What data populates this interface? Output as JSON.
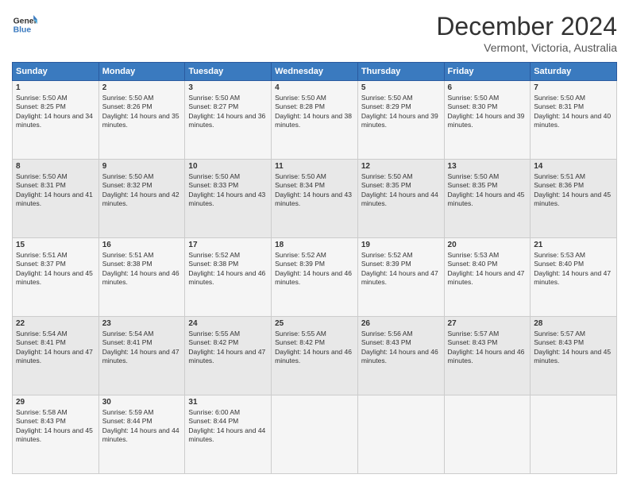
{
  "logo": {
    "line1": "General",
    "line2": "Blue"
  },
  "title": "December 2024",
  "location": "Vermont, Victoria, Australia",
  "days_header": [
    "Sunday",
    "Monday",
    "Tuesday",
    "Wednesday",
    "Thursday",
    "Friday",
    "Saturday"
  ],
  "weeks": [
    [
      {
        "day": "1",
        "sunrise": "5:50 AM",
        "sunset": "8:25 PM",
        "daylight": "14 hours and 34 minutes."
      },
      {
        "day": "2",
        "sunrise": "5:50 AM",
        "sunset": "8:26 PM",
        "daylight": "14 hours and 35 minutes."
      },
      {
        "day": "3",
        "sunrise": "5:50 AM",
        "sunset": "8:27 PM",
        "daylight": "14 hours and 36 minutes."
      },
      {
        "day": "4",
        "sunrise": "5:50 AM",
        "sunset": "8:28 PM",
        "daylight": "14 hours and 38 minutes."
      },
      {
        "day": "5",
        "sunrise": "5:50 AM",
        "sunset": "8:29 PM",
        "daylight": "14 hours and 39 minutes."
      },
      {
        "day": "6",
        "sunrise": "5:50 AM",
        "sunset": "8:30 PM",
        "daylight": "14 hours and 39 minutes."
      },
      {
        "day": "7",
        "sunrise": "5:50 AM",
        "sunset": "8:31 PM",
        "daylight": "14 hours and 40 minutes."
      }
    ],
    [
      {
        "day": "8",
        "sunrise": "5:50 AM",
        "sunset": "8:31 PM",
        "daylight": "14 hours and 41 minutes."
      },
      {
        "day": "9",
        "sunrise": "5:50 AM",
        "sunset": "8:32 PM",
        "daylight": "14 hours and 42 minutes."
      },
      {
        "day": "10",
        "sunrise": "5:50 AM",
        "sunset": "8:33 PM",
        "daylight": "14 hours and 43 minutes."
      },
      {
        "day": "11",
        "sunrise": "5:50 AM",
        "sunset": "8:34 PM",
        "daylight": "14 hours and 43 minutes."
      },
      {
        "day": "12",
        "sunrise": "5:50 AM",
        "sunset": "8:35 PM",
        "daylight": "14 hours and 44 minutes."
      },
      {
        "day": "13",
        "sunrise": "5:50 AM",
        "sunset": "8:35 PM",
        "daylight": "14 hours and 45 minutes."
      },
      {
        "day": "14",
        "sunrise": "5:51 AM",
        "sunset": "8:36 PM",
        "daylight": "14 hours and 45 minutes."
      }
    ],
    [
      {
        "day": "15",
        "sunrise": "5:51 AM",
        "sunset": "8:37 PM",
        "daylight": "14 hours and 45 minutes."
      },
      {
        "day": "16",
        "sunrise": "5:51 AM",
        "sunset": "8:38 PM",
        "daylight": "14 hours and 46 minutes."
      },
      {
        "day": "17",
        "sunrise": "5:52 AM",
        "sunset": "8:38 PM",
        "daylight": "14 hours and 46 minutes."
      },
      {
        "day": "18",
        "sunrise": "5:52 AM",
        "sunset": "8:39 PM",
        "daylight": "14 hours and 46 minutes."
      },
      {
        "day": "19",
        "sunrise": "5:52 AM",
        "sunset": "8:39 PM",
        "daylight": "14 hours and 47 minutes."
      },
      {
        "day": "20",
        "sunrise": "5:53 AM",
        "sunset": "8:40 PM",
        "daylight": "14 hours and 47 minutes."
      },
      {
        "day": "21",
        "sunrise": "5:53 AM",
        "sunset": "8:40 PM",
        "daylight": "14 hours and 47 minutes."
      }
    ],
    [
      {
        "day": "22",
        "sunrise": "5:54 AM",
        "sunset": "8:41 PM",
        "daylight": "14 hours and 47 minutes."
      },
      {
        "day": "23",
        "sunrise": "5:54 AM",
        "sunset": "8:41 PM",
        "daylight": "14 hours and 47 minutes."
      },
      {
        "day": "24",
        "sunrise": "5:55 AM",
        "sunset": "8:42 PM",
        "daylight": "14 hours and 47 minutes."
      },
      {
        "day": "25",
        "sunrise": "5:55 AM",
        "sunset": "8:42 PM",
        "daylight": "14 hours and 46 minutes."
      },
      {
        "day": "26",
        "sunrise": "5:56 AM",
        "sunset": "8:43 PM",
        "daylight": "14 hours and 46 minutes."
      },
      {
        "day": "27",
        "sunrise": "5:57 AM",
        "sunset": "8:43 PM",
        "daylight": "14 hours and 46 minutes."
      },
      {
        "day": "28",
        "sunrise": "5:57 AM",
        "sunset": "8:43 PM",
        "daylight": "14 hours and 45 minutes."
      }
    ],
    [
      {
        "day": "29",
        "sunrise": "5:58 AM",
        "sunset": "8:43 PM",
        "daylight": "14 hours and 45 minutes."
      },
      {
        "day": "30",
        "sunrise": "5:59 AM",
        "sunset": "8:44 PM",
        "daylight": "14 hours and 44 minutes."
      },
      {
        "day": "31",
        "sunrise": "6:00 AM",
        "sunset": "8:44 PM",
        "daylight": "14 hours and 44 minutes."
      },
      null,
      null,
      null,
      null
    ]
  ],
  "labels": {
    "sunrise_prefix": "Sunrise: ",
    "sunset_prefix": "Sunset: ",
    "daylight_prefix": "Daylight: "
  }
}
